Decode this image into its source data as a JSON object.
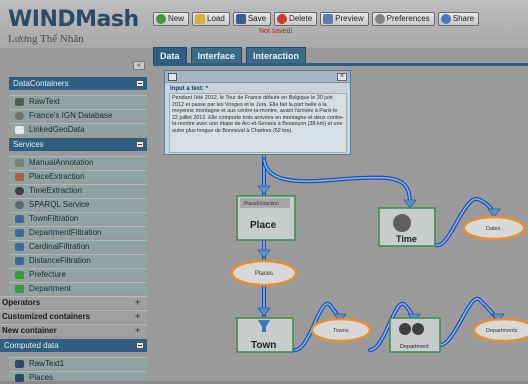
{
  "app": {
    "title": "WINDMash",
    "author": "Lương Thế Nhân"
  },
  "toolbar": {
    "new_label": "New",
    "load_label": "Load",
    "save_label": "Save",
    "delete_label": "Delete",
    "preview_label": "Preview",
    "preferences_label": "Preferences",
    "share_label": "Share",
    "status": "Not saved!"
  },
  "tabs": [
    "Data",
    "Interface",
    "Interaction"
  ],
  "sidebar": {
    "collapse_label": "«",
    "datacontainers": {
      "title": "DataContainers",
      "items": [
        "RawText",
        "France's IGN Database",
        "LinkedGeoData"
      ]
    },
    "services": {
      "title": "Services",
      "items": [
        "ManualAnnotation",
        "PlaceExtraction",
        "TimeExtraction",
        "SPARQL Service",
        "TownFiltration",
        "DepartmentFiltration",
        "CardinalFiltration",
        "DistanceFiltration",
        "Prefecture",
        "Department"
      ]
    },
    "operators": "Operators",
    "customized": "Customized containers",
    "newcontainer": "New container",
    "computed": {
      "title": "Computed data",
      "items": [
        "RawText1",
        "Places"
      ]
    }
  },
  "dialog": {
    "label": "Input a text: *",
    "text": "Pendant l'été 2012, le Tour de France débute en Belgique le 30 juin 2012 et passe par les Vosges et le Jura. Elle fait la part belle à la moyenne montagne et aux contre-la-montre, avant l'arrivée à Paris le 22 juillet 2012. Elle comporte trois arrivées en montagne et deux contre-la-montre avec une étape de Arc-et-Senans à Besançon (38 km) et une autre plus longue de Bonneval à Chartres (52 km)."
  },
  "nodes": {
    "place_sub": "PlaceExtraction",
    "place": "Place",
    "places": "Places",
    "time": "Time",
    "dates": "Dates",
    "town": "Town",
    "towns": "Towns",
    "department": "Department",
    "departments": "Departments"
  },
  "colors": {
    "accent": "#2f5f80",
    "node_border": "#3a8a4a",
    "ellipse_border": "#e8902a",
    "pipe": "#2d6fd4"
  }
}
